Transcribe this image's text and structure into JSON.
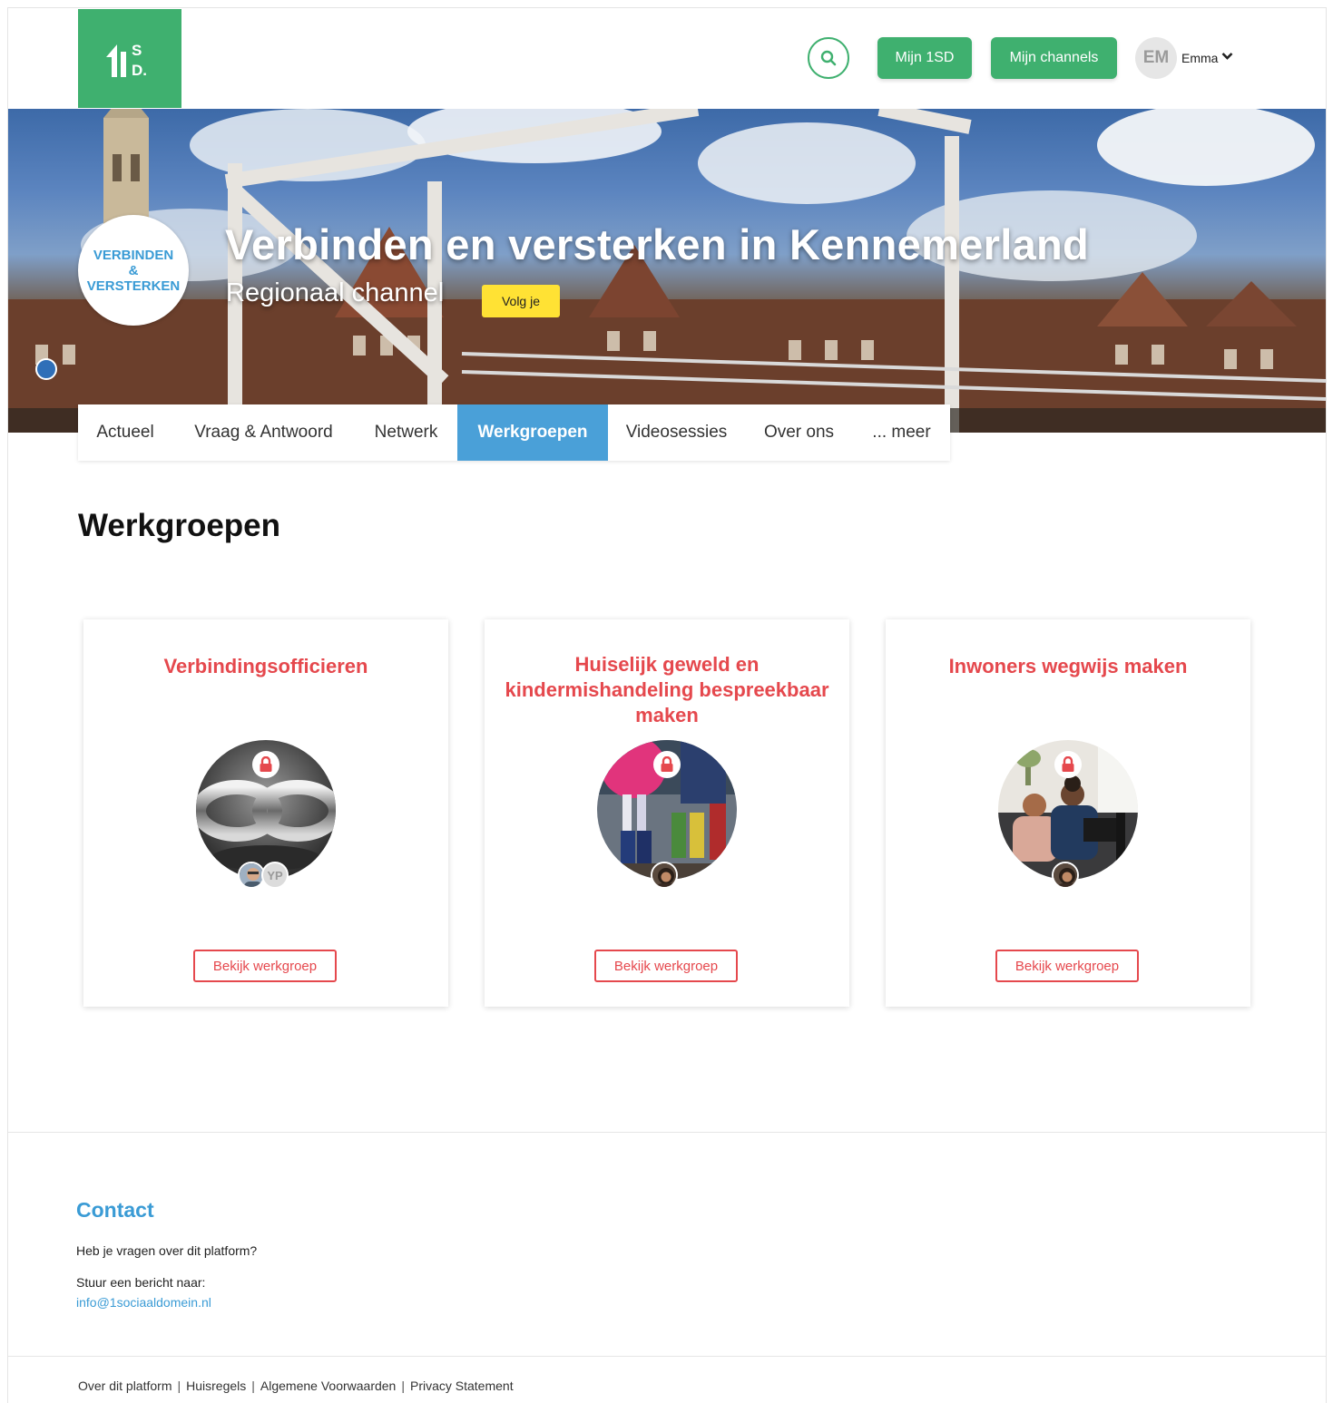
{
  "header": {
    "logo_text": "1SD.",
    "mijn1sd_label": "Mijn 1SD",
    "channels_label": "Mijn channels",
    "user_initials": "EM",
    "user_name": "Emma"
  },
  "hero": {
    "badge_line1": "VERBINDEN",
    "badge_line2": "&",
    "badge_line3": "VERSTERKEN",
    "title": "Verbinden en versterken in Kennemerland",
    "subtitle": "Regionaal channel",
    "follow_label": "Volg je"
  },
  "tabs": [
    {
      "label": "Actueel",
      "active": false
    },
    {
      "label": "Vraag & Antwoord",
      "active": false
    },
    {
      "label": "Netwerk",
      "active": false
    },
    {
      "label": "Werkgroepen",
      "active": true
    },
    {
      "label": "Videosessies",
      "active": false
    },
    {
      "label": "Over ons",
      "active": false
    },
    {
      "label": "... meer",
      "active": false
    }
  ],
  "section_title": "Werkgroepen",
  "cards": [
    {
      "title": "Verbindingsofficieren",
      "button_label": "Bekijk werkgroep",
      "member_initials": "YP",
      "icon": "lock-icon"
    },
    {
      "title": "Huiselijk geweld en kindermishandeling bespreekbaar maken",
      "button_label": "Bekijk werkgroep",
      "icon": "lock-icon"
    },
    {
      "title": "Inwoners wegwijs maken",
      "button_label": "Bekijk werkgroep",
      "icon": "lock-icon"
    }
  ],
  "footer": {
    "contact_title": "Contact",
    "question": "Heb je vragen over dit platform?",
    "send_message": "Stuur een bericht naar:",
    "email": "info@1sociaaldomein.nl",
    "links": [
      "Over dit platform",
      "Huisregels",
      "Algemene Voorwaarden",
      "Privacy Statement"
    ]
  },
  "colors": {
    "brand_green": "#3fb06f",
    "accent_blue": "#4aa0d8",
    "card_red": "#e5484d",
    "follow_yellow": "#ffe234"
  }
}
